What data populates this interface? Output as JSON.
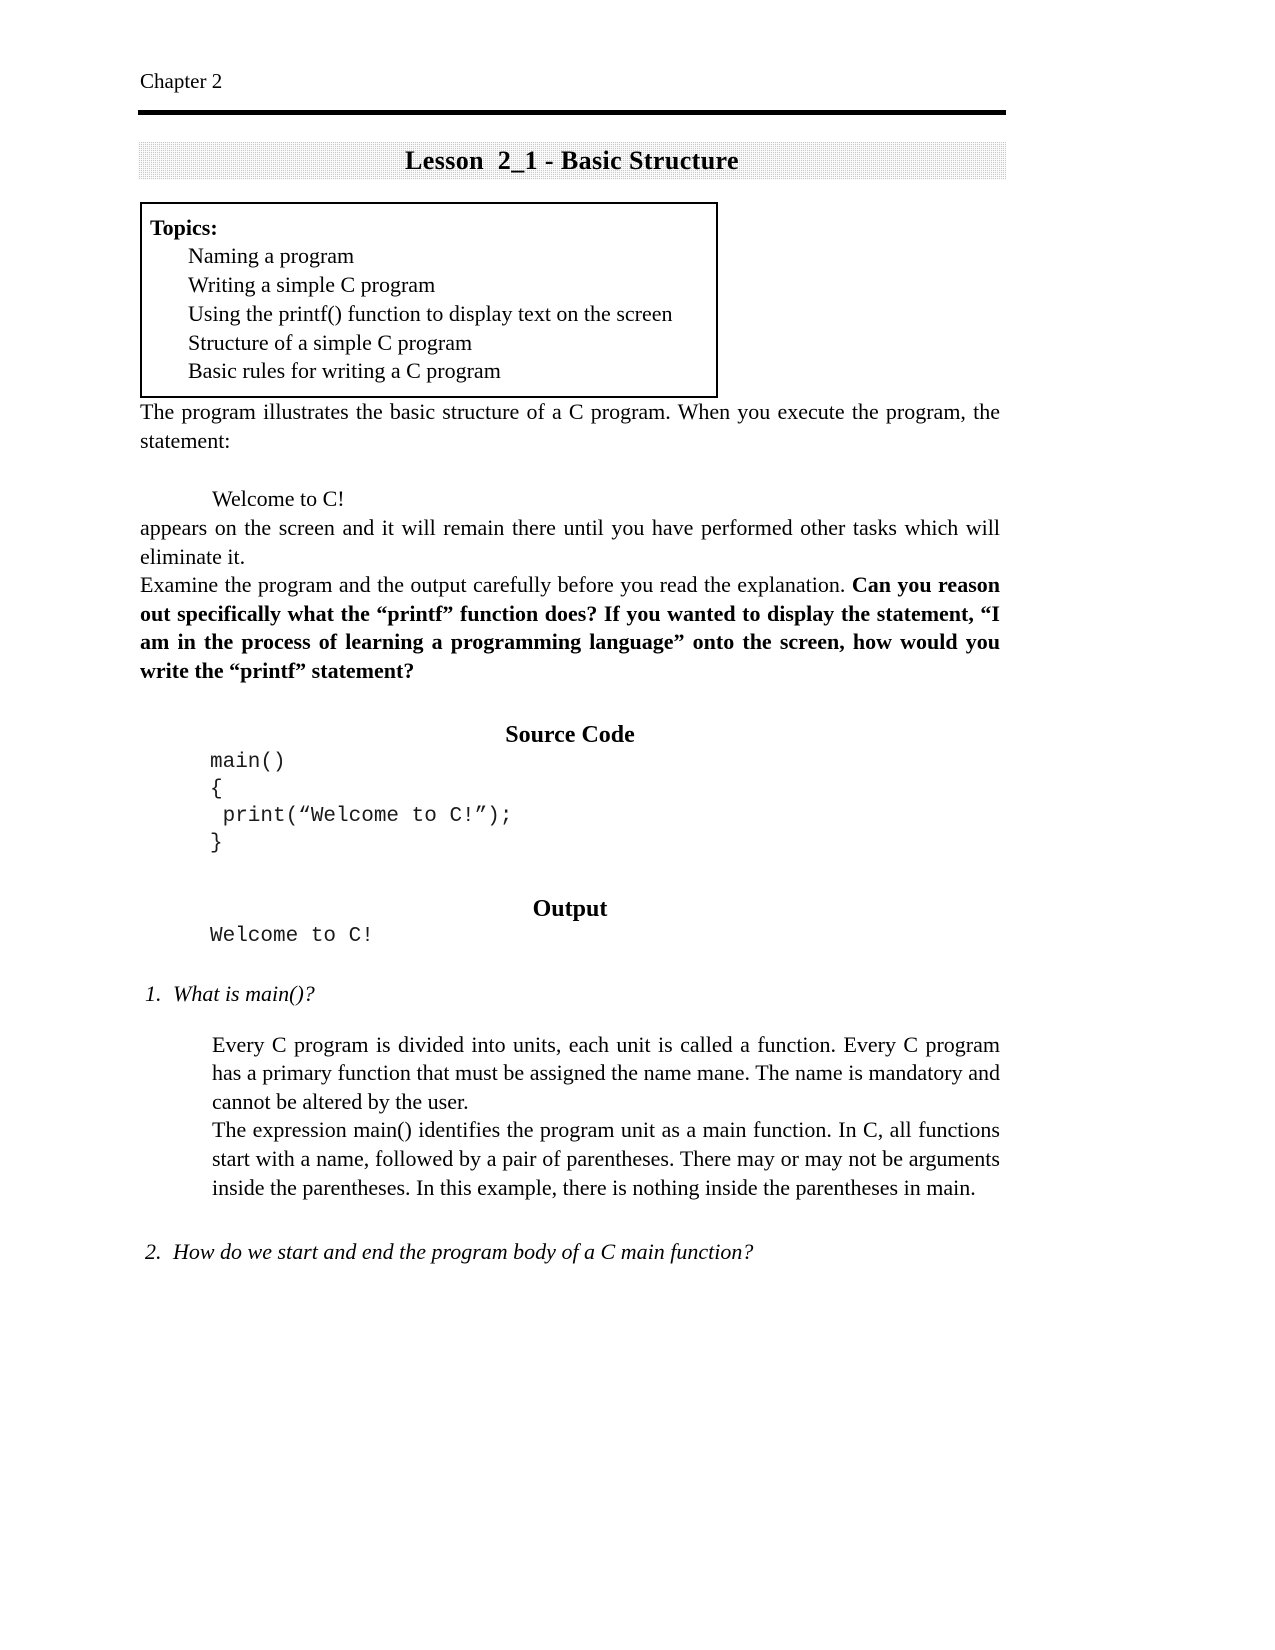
{
  "header": {
    "chapter": "Chapter 2",
    "banner_title": "Lesson  2_1 - Basic Structure"
  },
  "topics": {
    "heading": "Topics:",
    "items": [
      "Naming a program",
      "Writing a simple C program",
      "Using the printf() function to display text on the screen",
      "Structure of a simple C program",
      "Basic rules for writing a C program"
    ]
  },
  "body": {
    "intro": "The program illustrates the basic structure of a C program. When you execute  the program, the statement:",
    "statement": "Welcome to C!",
    "appears": "appears on the screen and it will remain there until you have performed other tasks which will eliminate it.",
    "examine_plain": "Examine the program and the output  carefully  before you read the explanation. ",
    "examine_bold": "Can you reason out specifically what the “printf” function does? If you wanted to display the statement, “I am in the process of learning a programming language” onto the screen, how would you write the “printf” statement?"
  },
  "source_section": {
    "heading": "Source Code",
    "code": "main()\n{\n print(“Welcome to C!”);\n}"
  },
  "output_section": {
    "heading": "Output",
    "text": "Welcome to C!"
  },
  "questions": [
    {
      "number": "1.",
      "text": "What is main()?",
      "answer_paragraphs": [
        "Every C program is divided into units, each unit is called a function. Every C program has a primary function that must be assigned the name mane. The name is mandatory and cannot be altered by the user.",
        "The expression main() identifies the program unit as a main function. In C, all functions start with a name, followed by a pair of parentheses. There may  or may not be arguments inside the parentheses. In this example, there is nothing inside the parentheses in main."
      ]
    },
    {
      "number": "2.",
      "text": "How  do we start  and end the program body of a C main function?",
      "answer_paragraphs": []
    }
  ],
  "colors": {
    "text": "#000000",
    "banner_background": "#c9c9c9",
    "page_background": "#ffffff"
  }
}
